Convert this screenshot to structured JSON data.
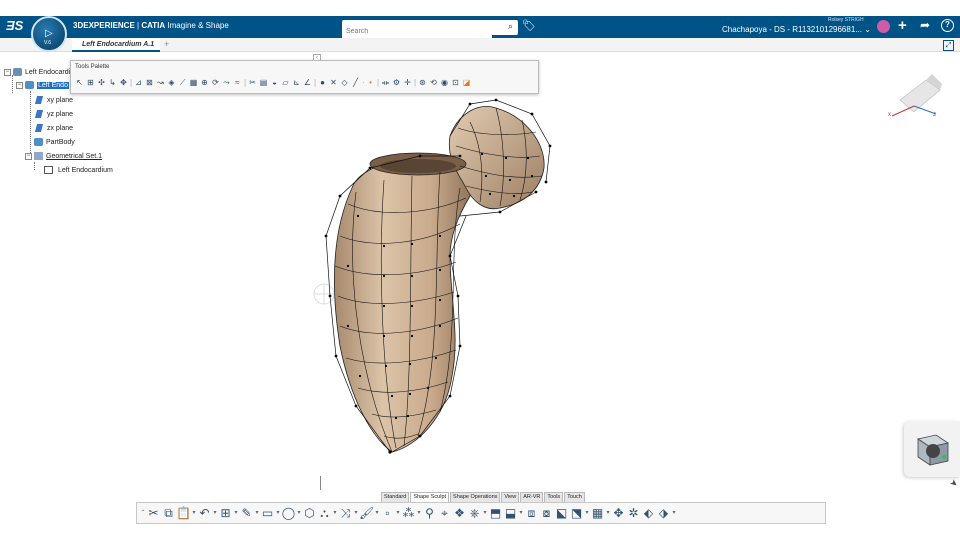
{
  "header": {
    "app_brand": "3DEXPERIENCE",
    "app_product": "CATIA",
    "app_role": "Imagine & Shape",
    "compass_version": "V.6",
    "search_placeholder": "Search",
    "user_name": "Rolsey STRIGH",
    "tenant": "Chachapoya - DS - R1132101296681...",
    "tenant_caret": "⌄"
  },
  "tabs": {
    "document_tab": "Left Endocardium A.1",
    "add_tab": "+"
  },
  "collapse_handle": "‹",
  "tree": {
    "root_label": "Left Endocardium A.1",
    "selected_label": "Left Endo",
    "items": [
      {
        "label": "xy plane"
      },
      {
        "label": "yz plane"
      },
      {
        "label": "zx plane"
      },
      {
        "label": "PartBody"
      },
      {
        "label": "Geometrical Set.1"
      },
      {
        "label": "Left Endocardium"
      }
    ]
  },
  "tools_palette": {
    "title": "Tools Palette"
  },
  "axis": {
    "x": "x",
    "z": "z"
  },
  "action_bar": {
    "tabs": [
      "Standard",
      "Shape Sculpt",
      "Shape Operations",
      "View",
      "AR-VR",
      "Tools",
      "Touch"
    ],
    "active_tab": "Shape Sculpt"
  },
  "colors": {
    "title_bar": "#005386",
    "selection": "#1c6fc6",
    "surface": "#c9aa8c",
    "wire": "#111111"
  }
}
